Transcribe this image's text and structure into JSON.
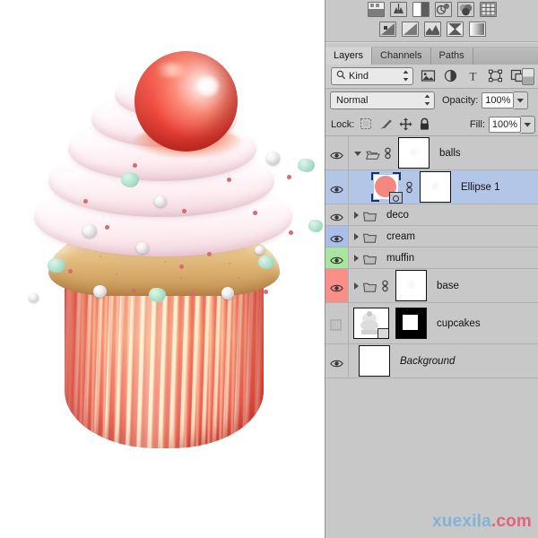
{
  "app": "Adobe Photoshop Layers Panel",
  "adjustments": {
    "row1": [
      {
        "name": "brightness-contrast-icon",
        "label": "Brightness/Contrast"
      },
      {
        "name": "levels-icon",
        "label": "Levels"
      },
      {
        "name": "curves-icon",
        "label": "Curves"
      },
      {
        "name": "exposure-icon",
        "label": "Exposure"
      },
      {
        "name": "vibrance-icon",
        "label": "Vibrance"
      },
      {
        "name": "hue-saturation-icon",
        "label": "Hue/Saturation"
      }
    ],
    "row2": [
      {
        "name": "color-balance-icon",
        "label": "Color Balance"
      },
      {
        "name": "black-white-icon",
        "label": "Black & White"
      },
      {
        "name": "photo-filter-icon",
        "label": "Photo Filter"
      },
      {
        "name": "channel-mixer-icon",
        "label": "Channel Mixer"
      },
      {
        "name": "color-lookup-icon",
        "label": "Color Lookup"
      }
    ]
  },
  "tabs": [
    {
      "label": "Layers",
      "active": true
    },
    {
      "label": "Channels",
      "active": false
    },
    {
      "label": "Paths",
      "active": false
    }
  ],
  "filter_bar": {
    "kind_label": "Kind",
    "icons": [
      "pixel-filter-icon",
      "adjustment-filter-icon",
      "type-filter-icon",
      "shape-filter-icon",
      "smart-object-filter-icon"
    ],
    "toggle_name": "filter-enable-toggle"
  },
  "blend": {
    "mode": "Normal",
    "opacity_label": "Opacity:",
    "opacity_value": "100%"
  },
  "lock": {
    "label": "Lock:",
    "items": [
      "lock-transparent-pixels-icon",
      "lock-image-pixels-icon",
      "lock-position-icon",
      "lock-all-icon"
    ],
    "fill_label": "Fill:",
    "fill_value": "100%"
  },
  "layers": [
    {
      "name": "balls",
      "type": "group",
      "visible": true,
      "selected": false,
      "expanded": true,
      "indent": 0,
      "linked": true,
      "has_mask": true,
      "mask_kind": "white",
      "italic": false,
      "eye_tint": "none"
    },
    {
      "name": "Ellipse 1",
      "type": "shape",
      "visible": true,
      "selected": true,
      "expanded": false,
      "indent": 1,
      "linked": true,
      "has_mask": true,
      "mask_kind": "white",
      "italic": false,
      "eye_tint": "none",
      "shape_color": "#f2887f"
    },
    {
      "name": "deco",
      "type": "group",
      "visible": true,
      "selected": false,
      "expanded": false,
      "indent": 0,
      "linked": false,
      "has_mask": false,
      "italic": false,
      "eye_tint": "none"
    },
    {
      "name": "cream",
      "type": "group",
      "visible": true,
      "selected": false,
      "expanded": false,
      "indent": 0,
      "linked": false,
      "has_mask": false,
      "italic": false,
      "eye_tint": "#a9bfe8"
    },
    {
      "name": "muffin",
      "type": "group",
      "visible": true,
      "selected": false,
      "expanded": false,
      "indent": 0,
      "linked": false,
      "has_mask": false,
      "italic": false,
      "eye_tint": "#a8e6a0"
    },
    {
      "name": "base",
      "type": "group",
      "visible": true,
      "selected": false,
      "expanded": false,
      "indent": 0,
      "linked": true,
      "has_mask": true,
      "mask_kind": "white",
      "italic": false,
      "eye_tint": "#f98f88"
    },
    {
      "name": "cupcakes",
      "type": "raster",
      "visible": false,
      "selected": false,
      "expanded": false,
      "indent": 0,
      "linked": false,
      "has_mask": true,
      "mask_kind": "black",
      "italic": false,
      "eye_tint": "none"
    },
    {
      "name": "Background",
      "type": "background",
      "visible": true,
      "selected": false,
      "expanded": false,
      "indent": 0,
      "linked": false,
      "has_mask": false,
      "italic": true,
      "eye_tint": "none"
    }
  ],
  "canvas": {
    "subject": "cupcake-illustration",
    "description": "Cupcake with white-pink whipped cream swirl, pearl beads, mint sprinkles, pink dots, red glossy sphere on top, golden sponge and striped red paper wrapper",
    "background_color": "#ffffff",
    "colors": {
      "cherry_red": "#f0473a",
      "cream_white": "#fffafc",
      "cream_pink": "#f6dde4",
      "muffin_gold": "#ddb273",
      "wrapper_red": "#f0715f",
      "pearl": "#e8e6e8",
      "mint": "#9fd9c2",
      "pink_dot": "#d96a72"
    }
  },
  "watermark": {
    "part1": "xuexila",
    "part2": ".com",
    "color1": "#7fb4d6",
    "color2": "#e8607f"
  }
}
